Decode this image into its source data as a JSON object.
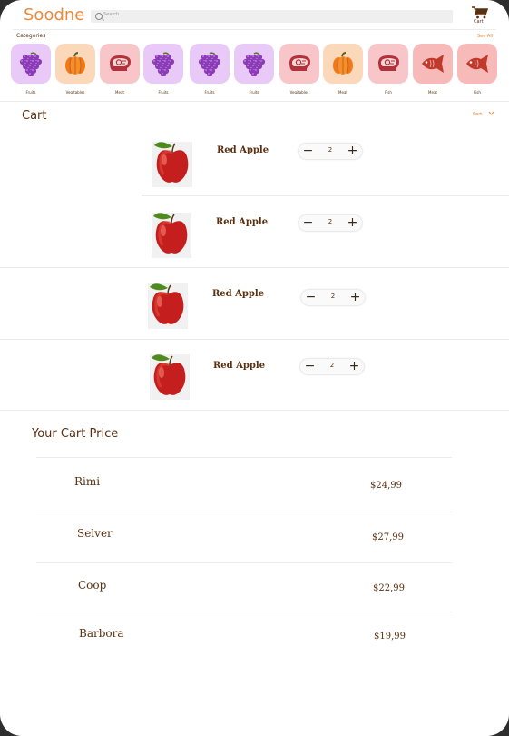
{
  "header": {
    "brand": "Soodne",
    "search_placeholder": "Search",
    "cart_label": "Cart"
  },
  "categories": {
    "title": "Categories",
    "see_all": "See All",
    "items": [
      {
        "label": "Fruits",
        "icon": "grapes-icon",
        "bg": "#e9c9f7"
      },
      {
        "label": "Vegitables",
        "icon": "pumpkin-icon",
        "bg": "#fcd8bb"
      },
      {
        "label": "Meat",
        "icon": "meat-icon",
        "bg": "#f8c6c9"
      },
      {
        "label": "Fruits",
        "icon": "grapes-icon",
        "bg": "#e9c9f7"
      },
      {
        "label": "Fruits",
        "icon": "grapes-icon",
        "bg": "#e9c9f7"
      },
      {
        "label": "Fruits",
        "icon": "grapes-icon",
        "bg": "#e9c9f7"
      },
      {
        "label": "Vegitables",
        "icon": "meat-icon",
        "bg": "#f8c6c9"
      },
      {
        "label": "Meat",
        "icon": "pumpkin-icon",
        "bg": "#fcd8bb"
      },
      {
        "label": "Fish",
        "icon": "meat-icon",
        "bg": "#f8c6c9"
      },
      {
        "label": "Meat",
        "icon": "fish-icon",
        "bg": "#f8b9b9"
      },
      {
        "label": "Fish",
        "icon": "fish-icon",
        "bg": "#f8b9b9"
      }
    ]
  },
  "cart": {
    "title": "Cart",
    "sort_label": "Sort",
    "items": [
      {
        "name": "Red Apple",
        "qty": "2"
      },
      {
        "name": "Red Apple",
        "qty": "2"
      },
      {
        "name": "Red Apple",
        "qty": "2"
      },
      {
        "name": "Red Apple",
        "qty": "2"
      }
    ]
  },
  "prices": {
    "title": "Your Cart Price",
    "stores": [
      {
        "name": "Rimi",
        "price": "$24,99"
      },
      {
        "name": "Selver",
        "price": "$27,99"
      },
      {
        "name": "Coop",
        "price": "$22,99"
      },
      {
        "name": "Barbora",
        "price": "$19,99"
      }
    ]
  },
  "colors": {
    "brand": "#e98a3c",
    "text": "#5a3010",
    "grape": "#8b3bb8",
    "pumpkin": "#f07a1a",
    "meat": "#b4303a",
    "fish": "#c0392b"
  }
}
